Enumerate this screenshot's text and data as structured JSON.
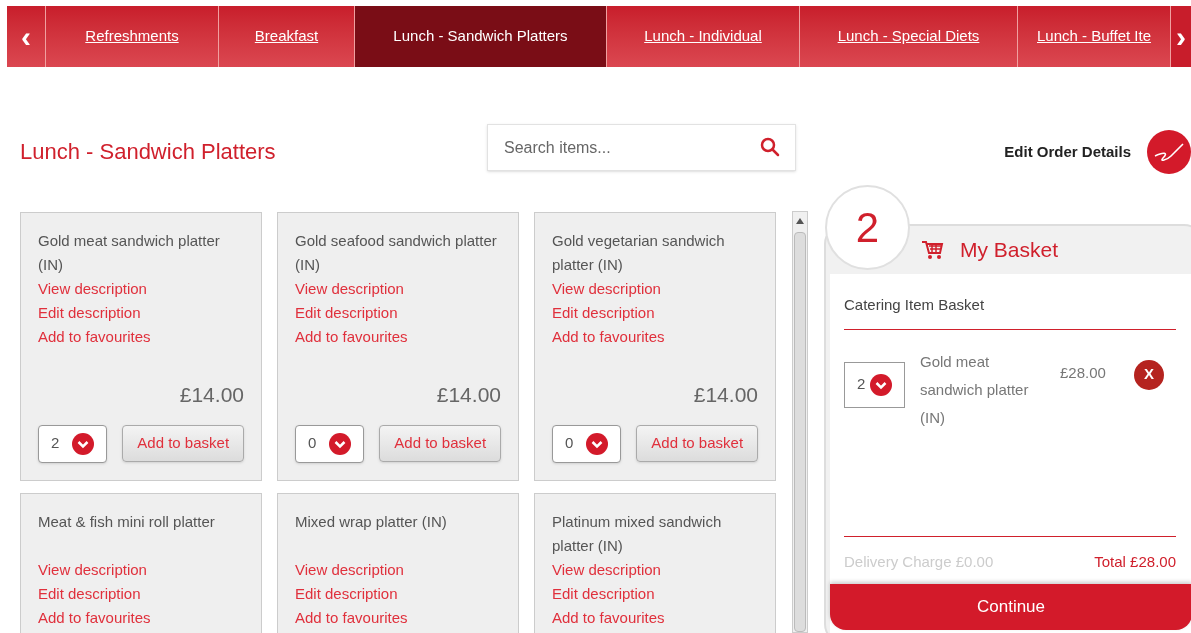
{
  "nav": {
    "prev": "‹",
    "next": "›",
    "tabs": [
      {
        "label": "Refreshments",
        "selected": false
      },
      {
        "label": "Breakfast",
        "selected": false
      },
      {
        "label": "Lunch - Sandwich Platters",
        "selected": true
      },
      {
        "label": "Lunch - Individual",
        "selected": false
      },
      {
        "label": "Lunch - Special Diets",
        "selected": false
      },
      {
        "label": "Lunch - Buffet Ite",
        "selected": false
      }
    ]
  },
  "heading": "Lunch - Sandwich Platters",
  "search": {
    "placeholder": "Search items..."
  },
  "edit_order": "Edit Order Details",
  "products": [
    {
      "name": "Gold meat sandwich platter (IN)",
      "links": [
        "View description",
        "Edit description",
        "Add to favourites"
      ],
      "price": "£14.00",
      "quantity": "2",
      "add": "Add to basket"
    },
    {
      "name": "Gold seafood sandwich platter (IN)",
      "links": [
        "View description",
        "Edit description",
        "Add to favourites"
      ],
      "price": "£14.00",
      "quantity": "0",
      "add": "Add to basket"
    },
    {
      "name": "Gold vegetarian sandwich platter (IN)",
      "links": [
        "View description",
        "Edit description",
        "Add to favourites"
      ],
      "price": "£14.00",
      "quantity": "0",
      "add": "Add to basket"
    },
    {
      "name": "Meat & fish mini roll platter",
      "links": [
        "View description",
        "Edit description",
        "Add to favourites"
      ]
    },
    {
      "name": "Mixed wrap platter (IN)",
      "links": [
        "View description",
        "Edit description",
        "Add to favourites"
      ]
    },
    {
      "name": "Platinum mixed sandwich platter (IN)",
      "links": [
        "View description",
        "Edit description",
        "Add to favourites"
      ]
    }
  ],
  "basket": {
    "count": "2",
    "title": "My Basket",
    "subtitle": "Catering Item Basket",
    "items": [
      {
        "quantity": "2",
        "name": "Gold meat sandwich platter (IN)",
        "price": "£28.00",
        "remove": "X"
      }
    ],
    "delivery": "Delivery Charge £0.00",
    "total": "Total £28.00",
    "continue": "Continue"
  }
}
